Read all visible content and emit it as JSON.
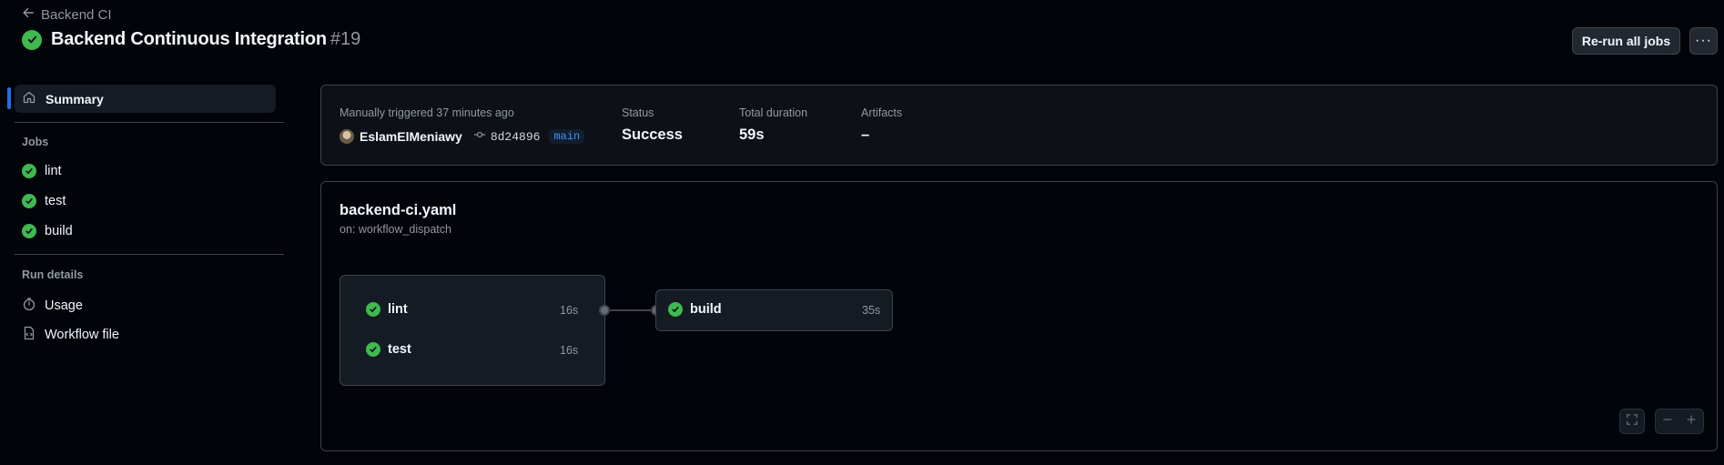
{
  "header": {
    "back_label": "Backend CI",
    "title": "Backend Continuous Integration",
    "run_number": "#19",
    "rerun_label": "Re-run all jobs",
    "more_label": "···"
  },
  "sidebar": {
    "summary_label": "Summary",
    "jobs_heading": "Jobs",
    "jobs": [
      {
        "label": "lint",
        "status": "success"
      },
      {
        "label": "test",
        "status": "success"
      },
      {
        "label": "build",
        "status": "success"
      }
    ],
    "run_details_heading": "Run details",
    "details": [
      {
        "label": "Usage",
        "icon": "stopwatch-icon"
      },
      {
        "label": "Workflow file",
        "icon": "file-code-icon"
      }
    ]
  },
  "summary": {
    "trigger_text": "Manually triggered 37 minutes ago",
    "actor": "EslamElMeniawy",
    "commit": "8d24896",
    "branch": "main",
    "status_label": "Status",
    "status_value": "Success",
    "duration_label": "Total duration",
    "duration_value": "59s",
    "artifacts_label": "Artifacts",
    "artifacts_value": "–"
  },
  "graph": {
    "workflow_file": "backend-ci.yaml",
    "trigger": "on: workflow_dispatch",
    "group_jobs": [
      {
        "name": "lint",
        "duration": "16s"
      },
      {
        "name": "test",
        "duration": "16s"
      }
    ],
    "next_job": {
      "name": "build",
      "duration": "35s"
    }
  },
  "colors": {
    "success": "#3fb950",
    "accent": "#1f6feb",
    "background": "#010409",
    "border": "#3d444d"
  }
}
